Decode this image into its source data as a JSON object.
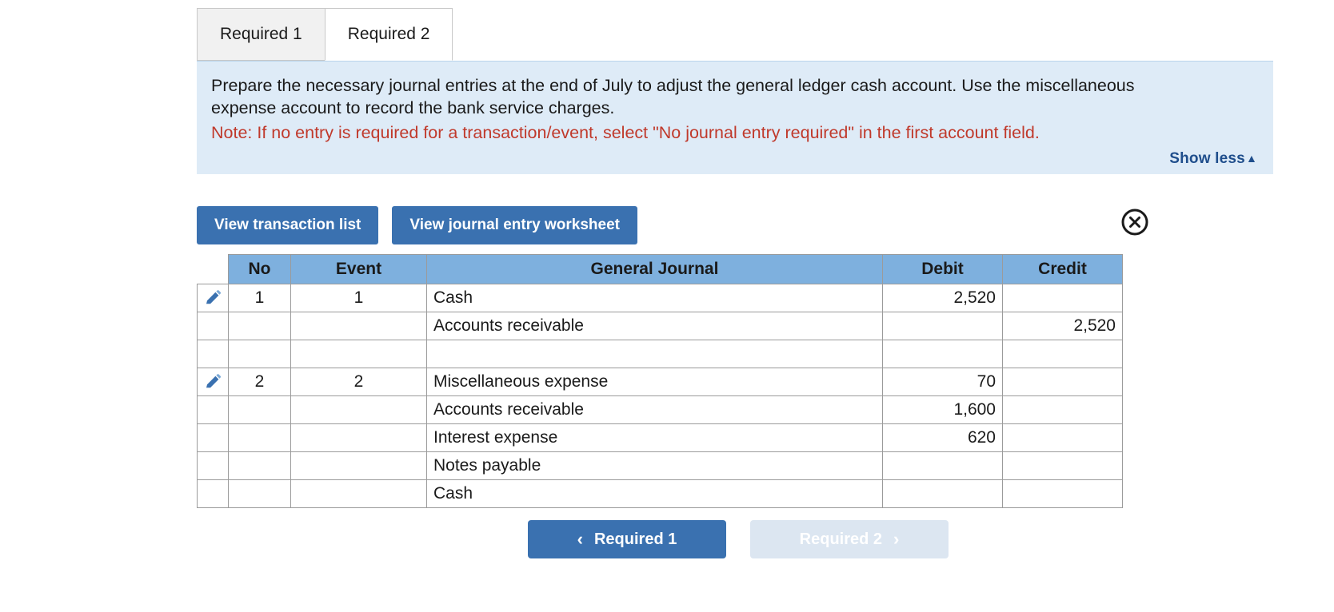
{
  "tabs": [
    {
      "label": "Required 1",
      "active": false
    },
    {
      "label": "Required 2",
      "active": true
    }
  ],
  "instructions": {
    "body": "Prepare the necessary journal entries at the end of July to adjust the general ledger cash account. Use the miscellaneous expense account to record the bank service charges.",
    "note": "Note: If no entry is required for a transaction/event, select \"No journal entry required\" in the first account field.",
    "show_less_label": "Show less",
    "show_less_caret": "▲"
  },
  "actions": {
    "view_transaction_list": "View transaction list",
    "view_journal_entry_worksheet": "View journal entry worksheet",
    "close_icon": "close-circle-icon"
  },
  "table": {
    "headers": [
      "No",
      "Event",
      "General Journal",
      "Debit",
      "Credit"
    ],
    "rows": [
      {
        "pencil": true,
        "no": "1",
        "event": "1",
        "account": "Cash",
        "indent": false,
        "debit": "2,520",
        "credit": ""
      },
      {
        "pencil": false,
        "no": "",
        "event": "",
        "account": "Accounts receivable",
        "indent": true,
        "debit": "",
        "credit": "2,520"
      },
      {
        "pencil": false,
        "no": "",
        "event": "",
        "account": "",
        "indent": false,
        "debit": "",
        "credit": ""
      },
      {
        "pencil": true,
        "no": "2",
        "event": "2",
        "account": "Miscellaneous expense",
        "indent": false,
        "debit": "70",
        "credit": ""
      },
      {
        "pencil": false,
        "no": "",
        "event": "",
        "account": "Accounts receivable",
        "indent": false,
        "debit": "1,600",
        "credit": ""
      },
      {
        "pencil": false,
        "no": "",
        "event": "",
        "account": "Interest expense",
        "indent": false,
        "debit": "620",
        "credit": ""
      },
      {
        "pencil": false,
        "no": "",
        "event": "",
        "account": "Notes payable",
        "indent": false,
        "debit": "",
        "credit": ""
      },
      {
        "pencil": false,
        "no": "",
        "event": "",
        "account": "Cash",
        "indent": false,
        "debit": "",
        "credit": ""
      }
    ]
  },
  "nav": {
    "prev_label": "Required 1",
    "prev_chevron": "‹",
    "next_label": "Required 2",
    "next_chevron": "›"
  },
  "colors": {
    "header_blue": "#7EB0DE",
    "panel_blue": "#DEEBF7",
    "button_blue": "#3A71B0",
    "note_red": "#C0392B",
    "link_blue": "#1F4E8C",
    "disabled_blue": "#DCE6F1"
  }
}
